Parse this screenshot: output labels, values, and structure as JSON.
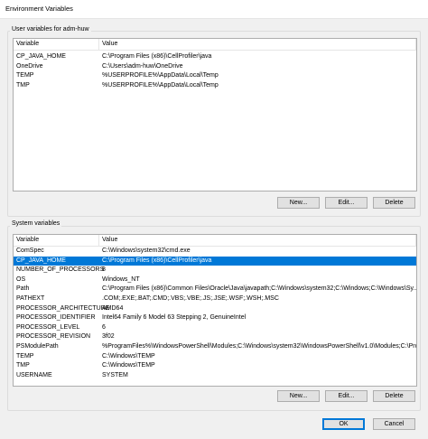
{
  "window": {
    "title": "Environment Variables"
  },
  "user_section": {
    "label": "User variables for adm-huw",
    "columns": {
      "variable": "Variable",
      "value": "Value"
    },
    "rows": [
      {
        "variable": "CP_JAVA_HOME",
        "value": "C:\\Program Files (x86)\\CellProfiler\\java"
      },
      {
        "variable": "OneDrive",
        "value": "C:\\Users\\adm-huw\\OneDrive"
      },
      {
        "variable": "TEMP",
        "value": "%USERPROFILE%\\AppData\\Local\\Temp"
      },
      {
        "variable": "TMP",
        "value": "%USERPROFILE%\\AppData\\Local\\Temp"
      }
    ],
    "buttons": {
      "new": "New...",
      "edit": "Edit...",
      "delete": "Delete"
    }
  },
  "system_section": {
    "label": "System variables",
    "columns": {
      "variable": "Variable",
      "value": "Value"
    },
    "rows": [
      {
        "variable": "ComSpec",
        "value": "C:\\Windows\\system32\\cmd.exe"
      },
      {
        "variable": "CP_JAVA_HOME",
        "value": "C:\\Program Files (x86)\\CellProfiler\\java"
      },
      {
        "variable": "NUMBER_OF_PROCESSORS",
        "value": "8"
      },
      {
        "variable": "OS",
        "value": "Windows_NT"
      },
      {
        "variable": "Path",
        "value": "C:\\Program Files (x86)\\Common Files\\Oracle\\Java\\javapath;C:\\Windows\\system32;C:\\Windows;C:\\Windows\\Sy..."
      },
      {
        "variable": "PATHEXT",
        "value": ".COM;.EXE;.BAT;.CMD;.VBS;.VBE;.JS;.JSE;.WSF;.WSH;.MSC"
      },
      {
        "variable": "PROCESSOR_ARCHITECTURE",
        "value": "AMD64"
      },
      {
        "variable": "PROCESSOR_IDENTIFIER",
        "value": "Intel64 Family 6 Model 63 Stepping 2, GenuineIntel"
      },
      {
        "variable": "PROCESSOR_LEVEL",
        "value": "6"
      },
      {
        "variable": "PROCESSOR_REVISION",
        "value": "3f02"
      },
      {
        "variable": "PSModulePath",
        "value": "%ProgramFiles%\\WindowsPowerShell\\Modules;C:\\Windows\\system32\\WindowsPowerShell\\v1.0\\Modules;C:\\Pro..."
      },
      {
        "variable": "TEMP",
        "value": "C:\\Windows\\TEMP"
      },
      {
        "variable": "TMP",
        "value": "C:\\Windows\\TEMP"
      },
      {
        "variable": "USERNAME",
        "value": "SYSTEM"
      }
    ],
    "selected_index": 1,
    "buttons": {
      "new": "New...",
      "edit": "Edit...",
      "delete": "Delete"
    }
  },
  "footer": {
    "ok": "OK",
    "cancel": "Cancel"
  }
}
